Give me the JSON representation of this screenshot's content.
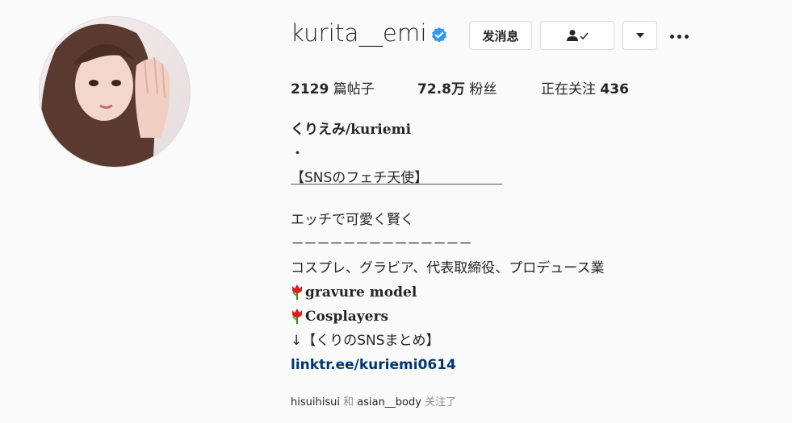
{
  "profile": {
    "username": "kurita__emi",
    "buttons": {
      "message": "发消息"
    },
    "stats": {
      "posts_value": "2129",
      "posts_label": "篇帖子",
      "followers_value": "72.8万",
      "followers_label": "粉丝",
      "following_label": "正在关注",
      "following_value": "436"
    },
    "bio": {
      "full_name": "くりえみ/kuriemi",
      "dot": "・",
      "tag": "【SNSのフェチ天使】",
      "line2": "エッチで可愛く賢く",
      "dashes": "－－－－－－－－－－－－－－",
      "roles": "コスプレ、グラビア、代表取締役、プロデュース業",
      "item1": "gravure model",
      "item2": "Cosplayers",
      "sns": "↓【くりのSNSまとめ】",
      "link": "linktr.ee/kuriemi0614"
    },
    "followed_by": {
      "user1": "hisuihisui",
      "conj": "和",
      "user2": "asian__body",
      "suffix": "关注了"
    }
  },
  "colors": {
    "verified": "#3897f0",
    "link": "#00376b",
    "border": "#dbdbdb"
  }
}
